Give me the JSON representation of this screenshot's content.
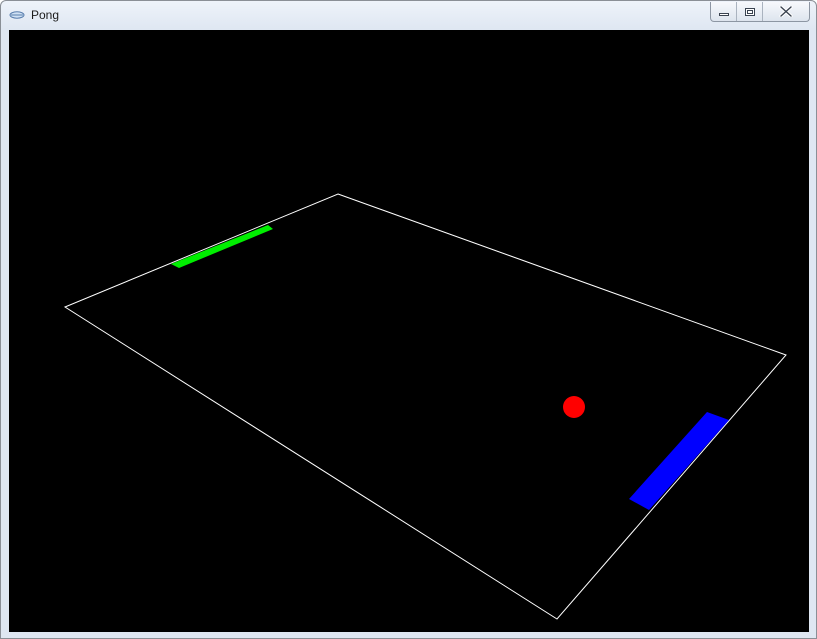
{
  "window": {
    "title": "Pong",
    "icon": "pong-app-icon"
  },
  "controls": {
    "minimize_icon": "minimize-icon",
    "maximize_icon": "restore-icon",
    "close_icon": "close-icon"
  },
  "game": {
    "background_color": "#000000",
    "field_line_color": "#ffffff",
    "left_paddle_color": "#00ee00",
    "right_paddle_color": "#0000ff",
    "ball_color": "#ff0000"
  }
}
